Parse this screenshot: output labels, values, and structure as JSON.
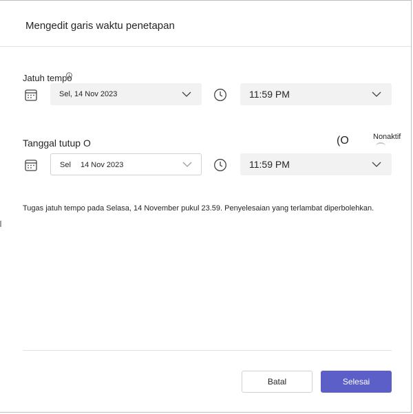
{
  "dialog": {
    "title": "Mengedit garis waktu penetapan"
  },
  "due": {
    "label": "Jatuh tempo",
    "date_value": "Sel, 14 Nov 2023",
    "time_value": "11:59 PM"
  },
  "close": {
    "label": "Tanggal tutup O",
    "toggle_glyph": "(O",
    "toggle_status": "Nonaktif",
    "date_day": "Sel",
    "date_value": "14 Nov 2023",
    "time_value": "11:59 PM"
  },
  "description": "Tugas jatuh tempo pada Selasa, 14 November pukul 23.59. Penyelesaian yang terlambat diperbolehkan.",
  "footer": {
    "cancel_label": "Batal",
    "done_label": "Selesai"
  },
  "colors": {
    "primary": "#5b5fc7",
    "field_fill": "#f2f2f2",
    "border": "#d1d1d1"
  },
  "icons": [
    "info-icon",
    "calendar-icon",
    "clock-icon",
    "chevron-down-icon"
  ]
}
